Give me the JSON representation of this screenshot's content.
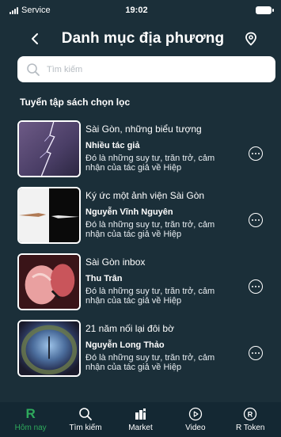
{
  "status": {
    "carrier": "Service",
    "time": "19:02"
  },
  "header": {
    "title": "Danh mục địa phương"
  },
  "search": {
    "placeholder": "Tìm kiếm"
  },
  "section": {
    "title": "Tuyển tập sách chọn lọc"
  },
  "books": [
    {
      "title": "Sài Gòn, những biểu tượng",
      "author": "Nhiều tác giả",
      "desc": "Đó là những suy tư, trăn trở, cảm nhận của tác giả về Hiệp",
      "cover": "lightning"
    },
    {
      "title": "Ký ức một ảnh viện Sài Gòn",
      "author": "Nguyễn Vĩnh Nguyên",
      "desc": "Đó là những suy tư, trăn trở, cảm nhận của tác giả về Hiệp",
      "cover": "hands"
    },
    {
      "title": "Sài Gòn inbox",
      "author": "Thu Trân",
      "desc": "Đó là những suy tư, trăn trở, cảm nhận của tác giả về Hiệp",
      "cover": "flamingo"
    },
    {
      "title": "21 năm nối lại đôi bờ",
      "author": "Nguyễn Long Thảo",
      "desc": "Đó là những suy tư, trăn trở, cảm nhận của tác giả về Hiệp",
      "cover": "planet"
    }
  ],
  "tabs": [
    {
      "label": "Hôm nay",
      "icon": "r-logo-icon",
      "active": true
    },
    {
      "label": "Tìm kiếm",
      "icon": "search-icon"
    },
    {
      "label": "Market",
      "icon": "market-icon"
    },
    {
      "label": "Video",
      "icon": "play-icon"
    },
    {
      "label": "R Token",
      "icon": "token-icon"
    }
  ],
  "colors": {
    "background": "#1b2f39",
    "tabbar": "#142833",
    "accent": "#2eaa5c"
  }
}
